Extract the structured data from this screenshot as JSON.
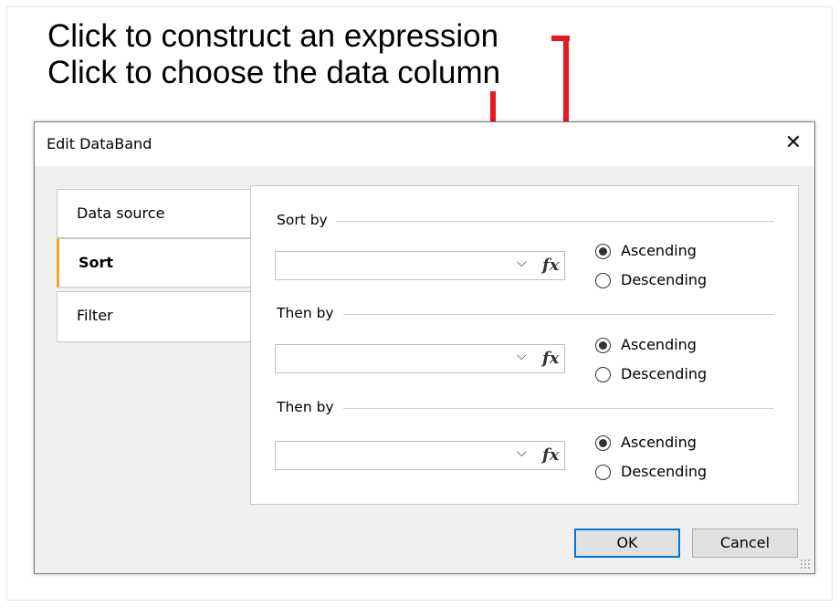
{
  "annotations": {
    "line1": "Click to construct an expression",
    "line2": "Click to choose the data column",
    "arrow_color": "#e8161d"
  },
  "dialog": {
    "title": "Edit DataBand",
    "close_icon": "close-icon"
  },
  "tabs": [
    {
      "label": "Data source",
      "active": false
    },
    {
      "label": "Sort",
      "active": true
    },
    {
      "label": "Filter",
      "active": false
    }
  ],
  "sort_groups": [
    {
      "label": "Sort by",
      "value": "",
      "fx_label": "fx",
      "order": "Ascending",
      "options": [
        "Ascending",
        "Descending"
      ]
    },
    {
      "label": "Then by",
      "value": "",
      "fx_label": "fx",
      "order": "Ascending",
      "options": [
        "Ascending",
        "Descending"
      ]
    },
    {
      "label": "Then by",
      "value": "",
      "fx_label": "fx",
      "order": "Ascending",
      "options": [
        "Ascending",
        "Descending"
      ]
    }
  ],
  "buttons": {
    "ok": "OK",
    "cancel": "Cancel"
  },
  "colors": {
    "active_tab_accent": "#f5a51c",
    "primary_button_border": "#0078d7"
  }
}
